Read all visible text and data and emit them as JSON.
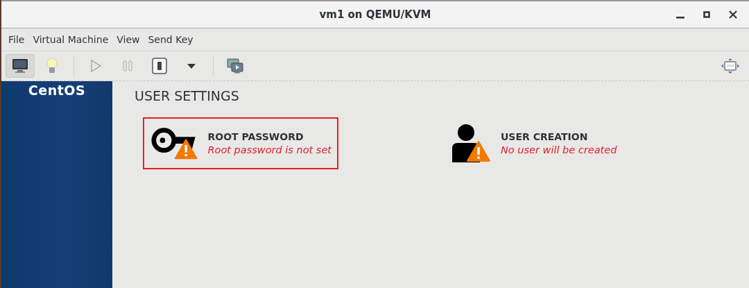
{
  "window": {
    "title": "vm1 on QEMU/KVM"
  },
  "menu": [
    "File",
    "Virtual Machine",
    "View",
    "Send Key"
  ],
  "toolbar": [
    {
      "kind": "monitor",
      "selected": true,
      "disabled": false
    },
    {
      "kind": "bulb",
      "selected": false,
      "disabled": false
    },
    {
      "kind": "separator"
    },
    {
      "kind": "play",
      "selected": false,
      "disabled": true
    },
    {
      "kind": "pause",
      "selected": false,
      "disabled": true
    },
    {
      "kind": "power",
      "selected": false,
      "disabled": false
    },
    {
      "kind": "caret",
      "selected": false,
      "disabled": false
    },
    {
      "kind": "separator"
    },
    {
      "kind": "screens",
      "selected": false,
      "disabled": false
    }
  ],
  "sidebar": {
    "logo": "CentOS"
  },
  "section": {
    "title": "USER SETTINGS"
  },
  "spokes": [
    {
      "kind": "key",
      "title": "ROOT PASSWORD",
      "status": "Root password is not set",
      "highlighted": true
    },
    {
      "kind": "user",
      "title": "USER CREATION",
      "status": "No user will be created",
      "highlighted": false
    }
  ]
}
